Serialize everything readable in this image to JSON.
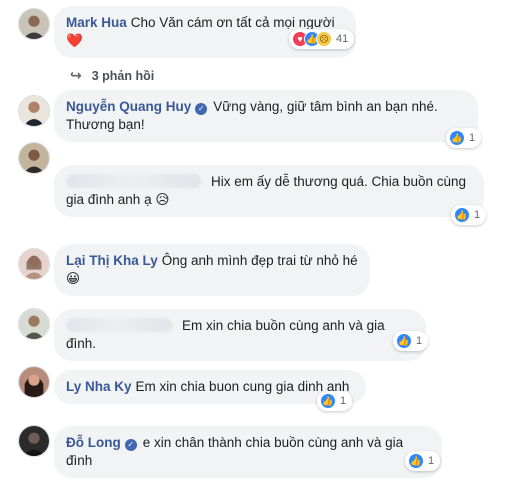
{
  "comments": [
    {
      "author": "Mark Hua",
      "verified": false,
      "text": "Cho Văn cám ơn tất cả mọi người",
      "emoji": "❤️",
      "reaction_count": "41",
      "reactions": [
        "love-icon",
        "like-icon",
        "sad-icon"
      ]
    },
    {
      "author": "Nguyễn Quang Huy",
      "verified": true,
      "text": "Vững vàng, giữ tâm bình an bạn nhé. Thương bạn!",
      "reaction_count": "1"
    },
    {
      "author": "",
      "verified": false,
      "text": "Hix em ấy dễ thương quá. Chia buồn cùng gia đình anh ạ",
      "emoji": "😥",
      "reaction_count": "1"
    },
    {
      "author": "Lại Thị Kha Ly",
      "verified": false,
      "text": "Ông anh mình đẹp trai từ nhỏ hé",
      "emoji": "😀"
    },
    {
      "author": "",
      "verified": false,
      "text": "Em xin chia buồn cùng anh và gia đình.",
      "reaction_count": "1"
    },
    {
      "author": "Ly Nha Ky",
      "verified": false,
      "text": "Em xin chia buon cung gia dinh anh",
      "reaction_count": "1"
    },
    {
      "author": "Đỗ Long",
      "verified": true,
      "text": "e xin chân thành chia buồn cùng anh và gia đình",
      "reaction_count": "1"
    }
  ],
  "replies_label": "3 phản hồi",
  "colors": {
    "author": "#385898",
    "bubble": "#f2f3f5",
    "like": "#2d88ff",
    "love": "#f33e58",
    "sad": "#f7c94b"
  }
}
